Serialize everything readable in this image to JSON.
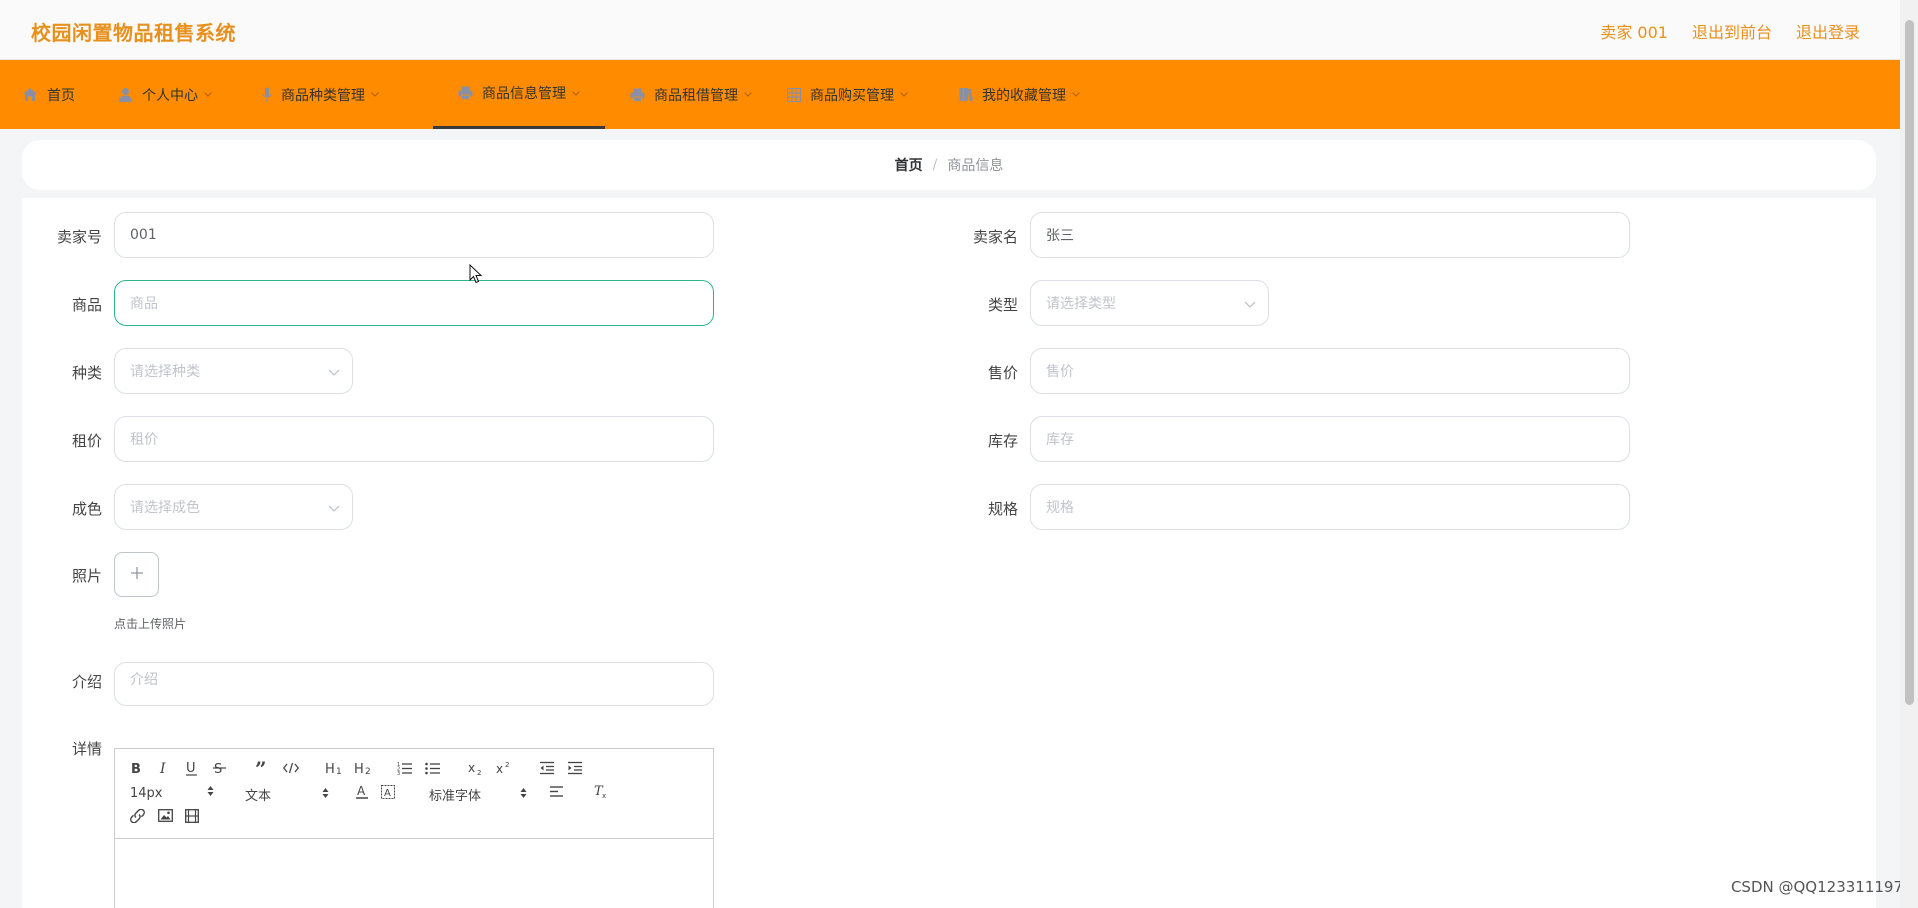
{
  "app": {
    "title": "校园闲置物品租售系统"
  },
  "top_links": {
    "user": "卖家 001",
    "to_front": "退出到前台",
    "logout": "退出登录"
  },
  "nav": [
    {
      "label": "首页",
      "icon": "home-icon",
      "has_menu": false
    },
    {
      "label": "个人中心",
      "icon": "user-icon",
      "has_menu": true
    },
    {
      "label": "商品种类管理",
      "icon": "microphone-icon",
      "has_menu": true
    },
    {
      "label": "商品信息管理",
      "icon": "printer-icon",
      "has_menu": true,
      "active": true
    },
    {
      "label": "商品租借管理",
      "icon": "printer-icon",
      "has_menu": true
    },
    {
      "label": "商品购买管理",
      "icon": "grid-icon",
      "has_menu": true
    },
    {
      "label": "我的收藏管理",
      "icon": "book-icon",
      "has_menu": true
    }
  ],
  "breadcrumb": {
    "home": "首页",
    "separator": "/",
    "current": "商品信息"
  },
  "form": {
    "seller_no": {
      "label": "卖家号",
      "value": "001"
    },
    "seller_name": {
      "label": "卖家名",
      "value": "张三"
    },
    "product": {
      "label": "商品",
      "placeholder": "商品"
    },
    "type": {
      "label": "类型",
      "placeholder": "请选择类型"
    },
    "category": {
      "label": "种类",
      "placeholder": "请选择种类"
    },
    "sale_price": {
      "label": "售价",
      "placeholder": "售价"
    },
    "rent_price": {
      "label": "租价",
      "placeholder": "租价"
    },
    "stock": {
      "label": "库存",
      "placeholder": "库存"
    },
    "condition": {
      "label": "成色",
      "placeholder": "请选择成色"
    },
    "spec": {
      "label": "规格",
      "placeholder": "规格"
    },
    "photo": {
      "label": "照片",
      "hint": "点击上传照片"
    },
    "intro": {
      "label": "介绍",
      "placeholder": "介绍"
    },
    "detail": {
      "label": "详情"
    }
  },
  "editor": {
    "size": "14px",
    "header": "文本",
    "font": "标准字体",
    "h1": "H1",
    "h2": "H2"
  },
  "watermark": "CSDN @QQ123311197",
  "colors": {
    "accent": "#e8901e",
    "nav_bg": "#ff8c00",
    "focus": "#2fb58e"
  }
}
